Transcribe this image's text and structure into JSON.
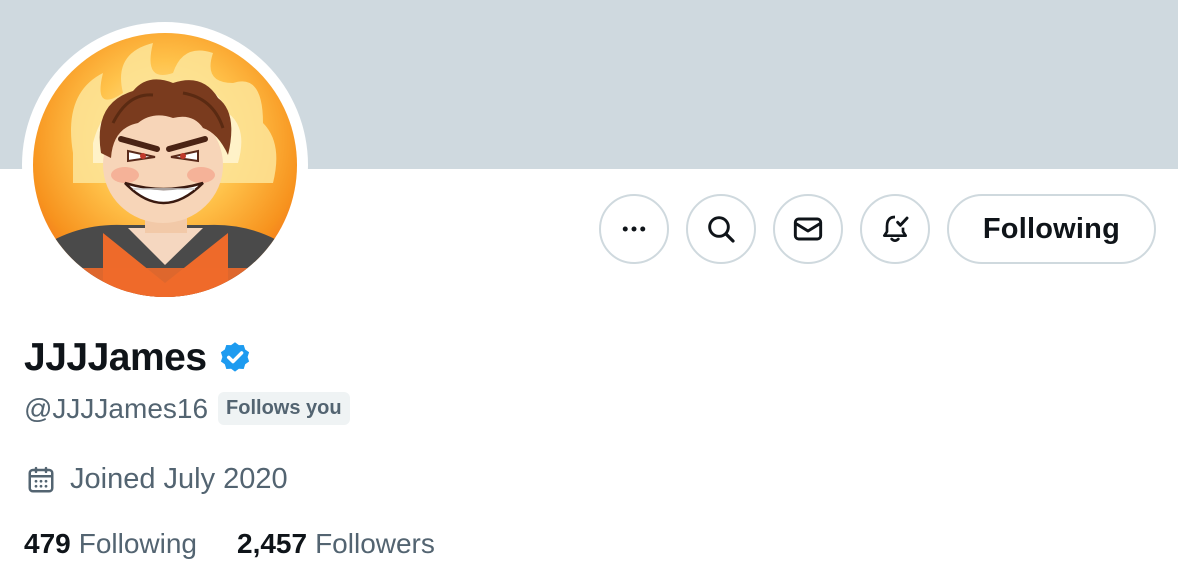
{
  "profile": {
    "display_name": "JJJJames",
    "handle": "@JJJJames16",
    "follows_you_badge": "Follows you",
    "joined": "Joined July 2020",
    "verified": true,
    "verified_color": "#1d9bf0"
  },
  "actions": {
    "more_icon": "more-icon",
    "search_icon": "search-icon",
    "message_icon": "envelope-icon",
    "notify_icon": "bell-check-icon",
    "follow_label": "Following"
  },
  "stats": {
    "following_count": "479",
    "following_label": "Following",
    "followers_count": "2,457",
    "followers_label": "Followers"
  },
  "colors": {
    "banner": "#cfd9df",
    "text_primary": "#0f1419",
    "text_secondary": "#536471",
    "border": "#cfd9de"
  }
}
